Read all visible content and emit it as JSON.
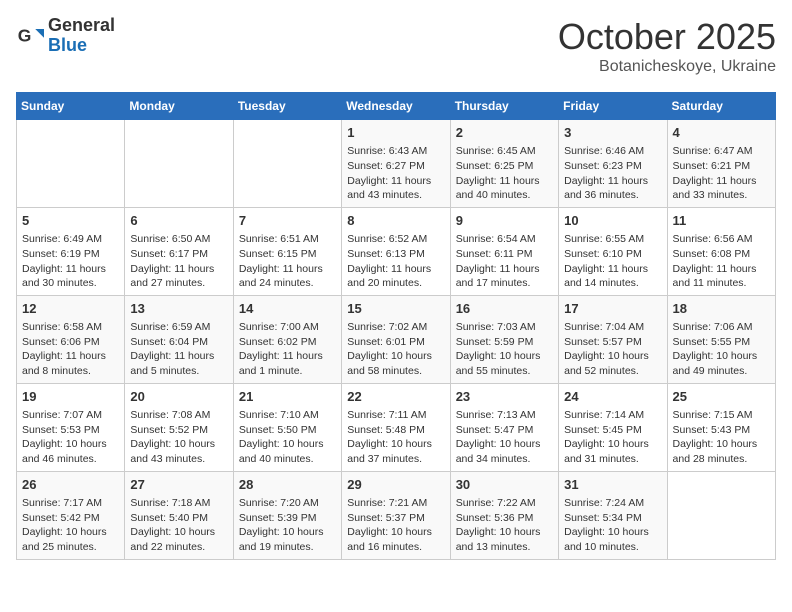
{
  "logo": {
    "general": "General",
    "blue": "Blue"
  },
  "header": {
    "month": "October 2025",
    "location": "Botanicheskoye, Ukraine"
  },
  "weekdays": [
    "Sunday",
    "Monday",
    "Tuesday",
    "Wednesday",
    "Thursday",
    "Friday",
    "Saturday"
  ],
  "weeks": [
    [
      {
        "day": "",
        "info": ""
      },
      {
        "day": "",
        "info": ""
      },
      {
        "day": "",
        "info": ""
      },
      {
        "day": "1",
        "info": "Sunrise: 6:43 AM\nSunset: 6:27 PM\nDaylight: 11 hours\nand 43 minutes."
      },
      {
        "day": "2",
        "info": "Sunrise: 6:45 AM\nSunset: 6:25 PM\nDaylight: 11 hours\nand 40 minutes."
      },
      {
        "day": "3",
        "info": "Sunrise: 6:46 AM\nSunset: 6:23 PM\nDaylight: 11 hours\nand 36 minutes."
      },
      {
        "day": "4",
        "info": "Sunrise: 6:47 AM\nSunset: 6:21 PM\nDaylight: 11 hours\nand 33 minutes."
      }
    ],
    [
      {
        "day": "5",
        "info": "Sunrise: 6:49 AM\nSunset: 6:19 PM\nDaylight: 11 hours\nand 30 minutes."
      },
      {
        "day": "6",
        "info": "Sunrise: 6:50 AM\nSunset: 6:17 PM\nDaylight: 11 hours\nand 27 minutes."
      },
      {
        "day": "7",
        "info": "Sunrise: 6:51 AM\nSunset: 6:15 PM\nDaylight: 11 hours\nand 24 minutes."
      },
      {
        "day": "8",
        "info": "Sunrise: 6:52 AM\nSunset: 6:13 PM\nDaylight: 11 hours\nand 20 minutes."
      },
      {
        "day": "9",
        "info": "Sunrise: 6:54 AM\nSunset: 6:11 PM\nDaylight: 11 hours\nand 17 minutes."
      },
      {
        "day": "10",
        "info": "Sunrise: 6:55 AM\nSunset: 6:10 PM\nDaylight: 11 hours\nand 14 minutes."
      },
      {
        "day": "11",
        "info": "Sunrise: 6:56 AM\nSunset: 6:08 PM\nDaylight: 11 hours\nand 11 minutes."
      }
    ],
    [
      {
        "day": "12",
        "info": "Sunrise: 6:58 AM\nSunset: 6:06 PM\nDaylight: 11 hours\nand 8 minutes."
      },
      {
        "day": "13",
        "info": "Sunrise: 6:59 AM\nSunset: 6:04 PM\nDaylight: 11 hours\nand 5 minutes."
      },
      {
        "day": "14",
        "info": "Sunrise: 7:00 AM\nSunset: 6:02 PM\nDaylight: 11 hours\nand 1 minute."
      },
      {
        "day": "15",
        "info": "Sunrise: 7:02 AM\nSunset: 6:01 PM\nDaylight: 10 hours\nand 58 minutes."
      },
      {
        "day": "16",
        "info": "Sunrise: 7:03 AM\nSunset: 5:59 PM\nDaylight: 10 hours\nand 55 minutes."
      },
      {
        "day": "17",
        "info": "Sunrise: 7:04 AM\nSunset: 5:57 PM\nDaylight: 10 hours\nand 52 minutes."
      },
      {
        "day": "18",
        "info": "Sunrise: 7:06 AM\nSunset: 5:55 PM\nDaylight: 10 hours\nand 49 minutes."
      }
    ],
    [
      {
        "day": "19",
        "info": "Sunrise: 7:07 AM\nSunset: 5:53 PM\nDaylight: 10 hours\nand 46 minutes."
      },
      {
        "day": "20",
        "info": "Sunrise: 7:08 AM\nSunset: 5:52 PM\nDaylight: 10 hours\nand 43 minutes."
      },
      {
        "day": "21",
        "info": "Sunrise: 7:10 AM\nSunset: 5:50 PM\nDaylight: 10 hours\nand 40 minutes."
      },
      {
        "day": "22",
        "info": "Sunrise: 7:11 AM\nSunset: 5:48 PM\nDaylight: 10 hours\nand 37 minutes."
      },
      {
        "day": "23",
        "info": "Sunrise: 7:13 AM\nSunset: 5:47 PM\nDaylight: 10 hours\nand 34 minutes."
      },
      {
        "day": "24",
        "info": "Sunrise: 7:14 AM\nSunset: 5:45 PM\nDaylight: 10 hours\nand 31 minutes."
      },
      {
        "day": "25",
        "info": "Sunrise: 7:15 AM\nSunset: 5:43 PM\nDaylight: 10 hours\nand 28 minutes."
      }
    ],
    [
      {
        "day": "26",
        "info": "Sunrise: 7:17 AM\nSunset: 5:42 PM\nDaylight: 10 hours\nand 25 minutes."
      },
      {
        "day": "27",
        "info": "Sunrise: 7:18 AM\nSunset: 5:40 PM\nDaylight: 10 hours\nand 22 minutes."
      },
      {
        "day": "28",
        "info": "Sunrise: 7:20 AM\nSunset: 5:39 PM\nDaylight: 10 hours\nand 19 minutes."
      },
      {
        "day": "29",
        "info": "Sunrise: 7:21 AM\nSunset: 5:37 PM\nDaylight: 10 hours\nand 16 minutes."
      },
      {
        "day": "30",
        "info": "Sunrise: 7:22 AM\nSunset: 5:36 PM\nDaylight: 10 hours\nand 13 minutes."
      },
      {
        "day": "31",
        "info": "Sunrise: 7:24 AM\nSunset: 5:34 PM\nDaylight: 10 hours\nand 10 minutes."
      },
      {
        "day": "",
        "info": ""
      }
    ]
  ]
}
